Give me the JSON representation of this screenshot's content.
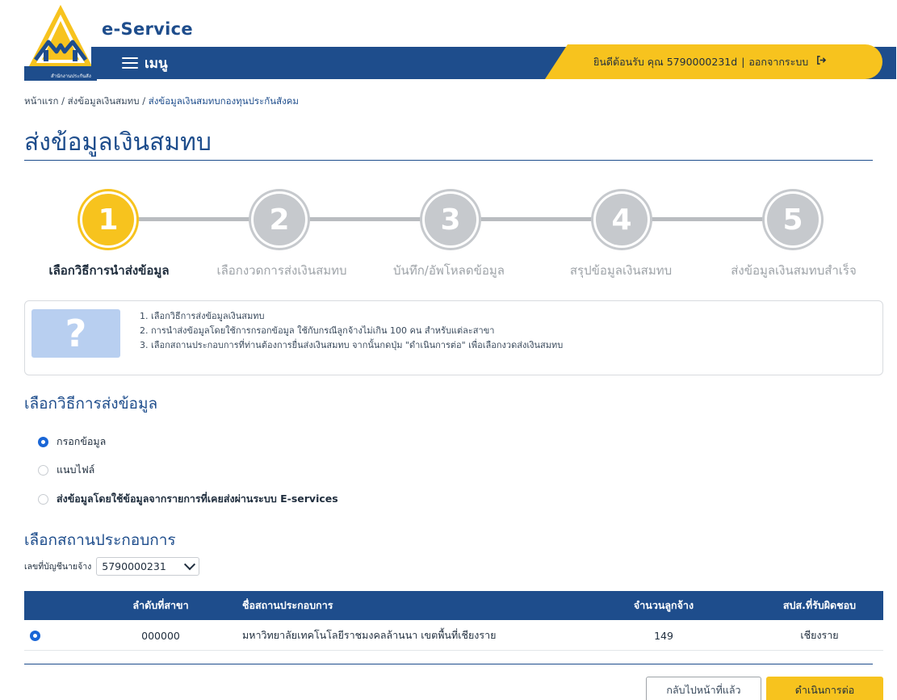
{
  "header": {
    "logo_caption": "สำนักงานประกันสังคม",
    "brand": "e-Service",
    "menu_label": "เมนู",
    "welcome_text": "ยินดีต้อนรับ คุณ 5790000231d",
    "separator": "|",
    "logout_label": "ออกจากระบบ"
  },
  "breadcrumb": {
    "home": "หน้าแรก",
    "sep1": " / ",
    "level2": "ส่งข้อมูลเงินสมทบ",
    "sep2": " / ",
    "current": "ส่งข้อมูลเงินสมทบกองทุนประกันสังคม"
  },
  "page_title": "ส่งข้อมูลเงินสมทบ",
  "stepper": {
    "steps": [
      {
        "num": "1",
        "label": "เลือกวิธีการนำส่งข้อมูล",
        "state": "active"
      },
      {
        "num": "2",
        "label": "เลือกงวดการส่งเงินสมทบ",
        "state": "inactive"
      },
      {
        "num": "3",
        "label": "บันทึก/อัพโหลดข้อมูล",
        "state": "inactive"
      },
      {
        "num": "4",
        "label": "สรุปข้อมูลเงินสมทบ",
        "state": "inactive"
      },
      {
        "num": "5",
        "label": "ส่งข้อมูลเงินสมทบสำเร็จ",
        "state": "inactive"
      }
    ]
  },
  "info": {
    "icon_glyph": "?",
    "lines": [
      "1. เลือกวิธีการส่งข้อมูลเงินสมทบ",
      "2. การนำส่งข้อมูลโดยใช้การกรอกข้อมูล ใช้กับกรณีลูกจ้างไม่เกิน 100 คน สำหรับแต่ละสาขา",
      "3. เลือกสถานประกอบการที่ท่านต้องการยื่นส่งเงินสมทบ จากนั้นกดปุ่ม \"ดำเนินการต่อ\" เพื่อเลือกงวดส่งเงินสมทบ"
    ]
  },
  "method_section": {
    "title": "เลือกวิธีการส่งข้อมูล",
    "options": [
      {
        "label": "กรอกข้อมูล",
        "checked": true
      },
      {
        "label": "แนบไฟล์",
        "checked": false
      },
      {
        "label": "ส่งข้อมูลโดยใช้ข้อมูลจากรายการที่เคยส่งผ่านระบบ E-services",
        "checked": false
      }
    ]
  },
  "establishment_section": {
    "title": "เลือกสถานประกอบการ",
    "account_label": "เลขที่บัญชีนายจ้าง",
    "account_value": "5790000231"
  },
  "table": {
    "headers": [
      "",
      "ลำดับที่สาขา",
      "ชื่อสถานประกอบการ",
      "จำนวนลูกจ้าง",
      "สปส.ที่รับผิดชอบ"
    ],
    "rows": [
      {
        "selected": true,
        "branch": "000000",
        "name": "มหาวิทยาลัยเทคโนโลยีราชมงคลล้านนา เขตพื้นที่เชียงราย",
        "employees": "149",
        "office": "เชียงราย"
      }
    ]
  },
  "buttons": {
    "back": "กลับไปหน้าที่แล้ว",
    "next": "ดำเนินการต่อ"
  },
  "colors": {
    "primary": "#1e4d8c",
    "accent": "#f7c31e",
    "inactive_step": "#c6c9cd",
    "radio_checked": "#1a66d6",
    "info_icon_bg": "#b8cff0"
  }
}
